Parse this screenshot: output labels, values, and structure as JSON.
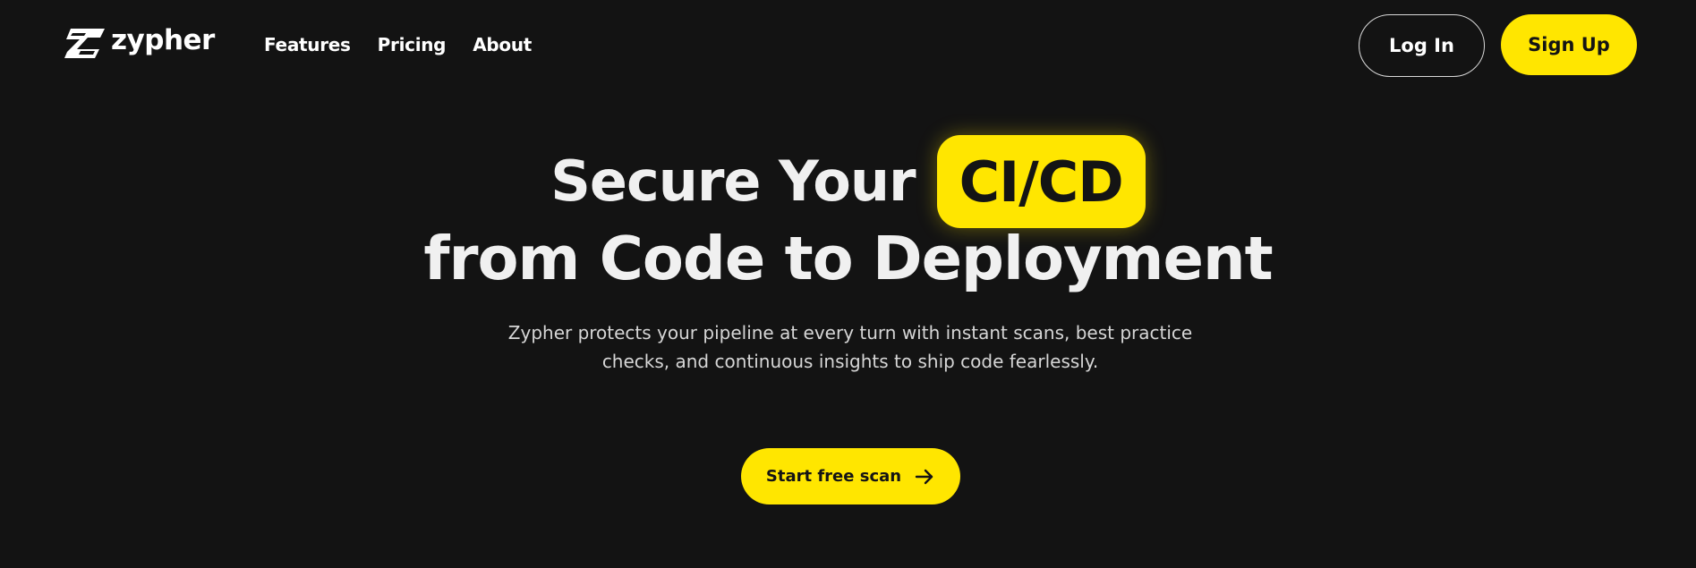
{
  "brand": {
    "name": "zypher",
    "logo_icon": "zypher-z-logo-icon",
    "accent_color": "#ffe600",
    "background_color": "#131313"
  },
  "nav": {
    "items": [
      {
        "label": "Features"
      },
      {
        "label": "Pricing"
      },
      {
        "label": "About"
      }
    ]
  },
  "auth": {
    "login_label": "Log In",
    "signup_label": "Sign Up"
  },
  "hero": {
    "title_prefix": "Secure Your",
    "title_highlight": "CI/CD",
    "title_line2": "from Code to Deployment",
    "subtitle": "Zypher protects your pipeline at every turn with instant scans, best practice checks, and continuous insights to ship code fearlessly.",
    "cta_label": "Start free scan",
    "cta_icon": "arrow-right-icon"
  }
}
